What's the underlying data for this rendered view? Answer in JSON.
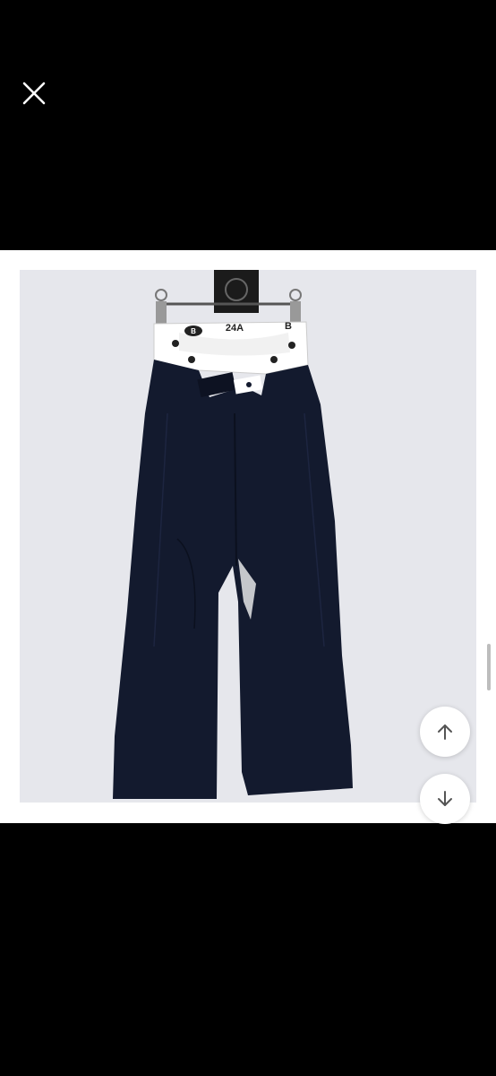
{
  "viewer": {
    "close_icon": "close-icon",
    "scroll_up_icon": "arrow-up-icon",
    "scroll_down_icon": "arrow-down-icon"
  },
  "product_image": {
    "waistband_text": "24A",
    "logo_letter": "B",
    "pants_color": "#131a2e",
    "waistband_color": "#ffffff",
    "background_color": "#e6e7ec"
  }
}
